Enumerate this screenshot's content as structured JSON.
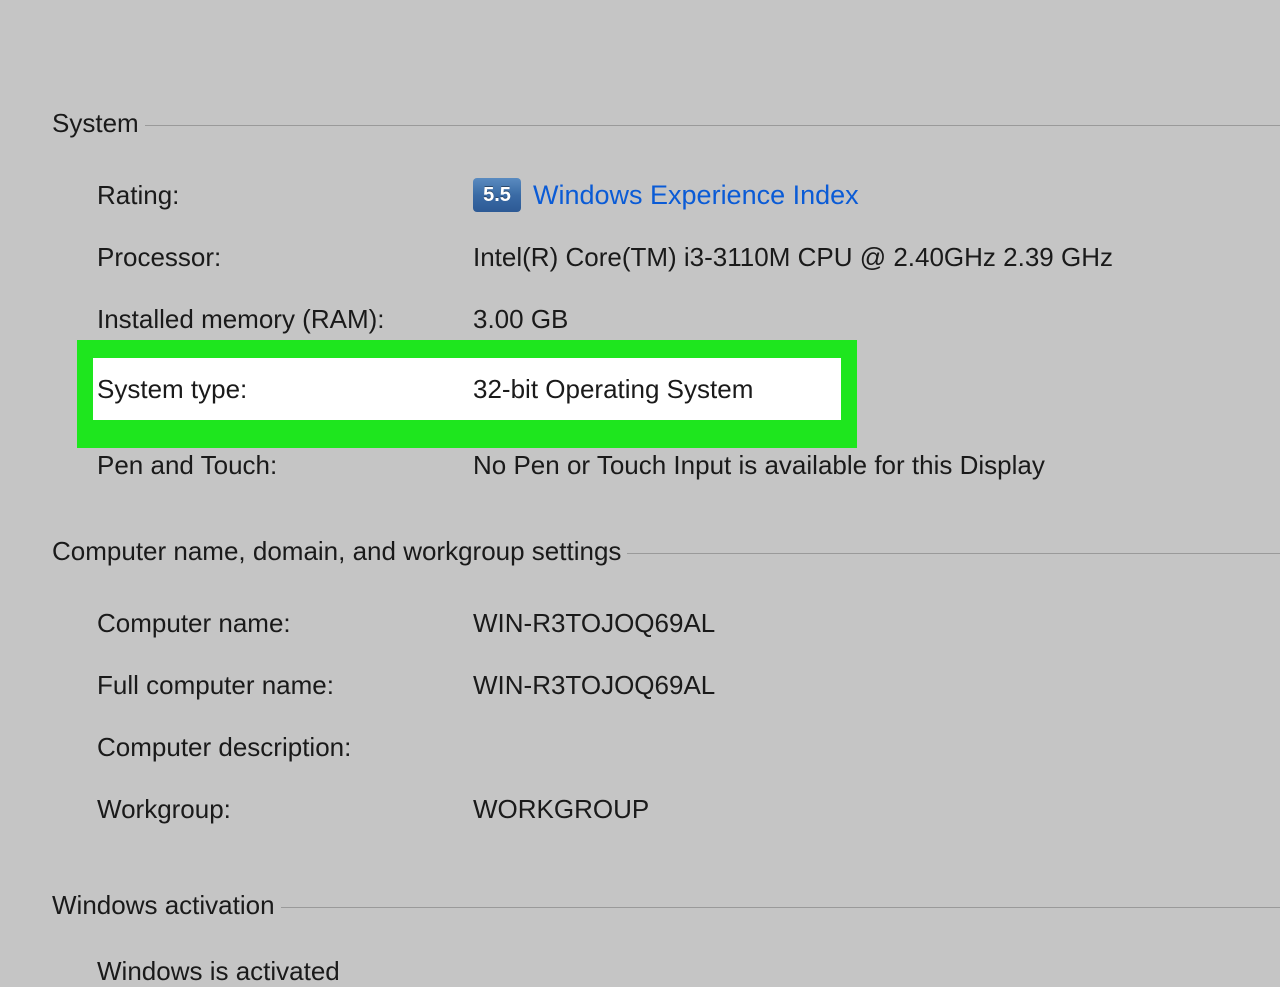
{
  "sections": {
    "system": {
      "title": "System",
      "rating_label": "Rating:",
      "rating_score": "5.5",
      "rating_link_text": "Windows Experience Index",
      "processor_label": "Processor:",
      "processor_value": "Intel(R) Core(TM) i3-3110M CPU @ 2.40GHz   2.39 GHz",
      "ram_label": "Installed memory (RAM):",
      "ram_value": "3.00 GB",
      "system_type_label": "System type:",
      "system_type_value": "32-bit Operating System",
      "pen_touch_label": "Pen and Touch:",
      "pen_touch_value": "No Pen or Touch Input is available for this Display"
    },
    "computer": {
      "title": "Computer name, domain, and workgroup settings",
      "computer_name_label": "Computer name:",
      "computer_name_value": "WIN-R3TOJOQ69AL",
      "full_name_label": "Full computer name:",
      "full_name_value": "WIN-R3TOJOQ69AL",
      "description_label": "Computer description:",
      "description_value": "",
      "workgroup_label": "Workgroup:",
      "workgroup_value": "WORKGROUP"
    },
    "activation": {
      "title": "Windows activation",
      "status": "Windows is activated"
    }
  }
}
